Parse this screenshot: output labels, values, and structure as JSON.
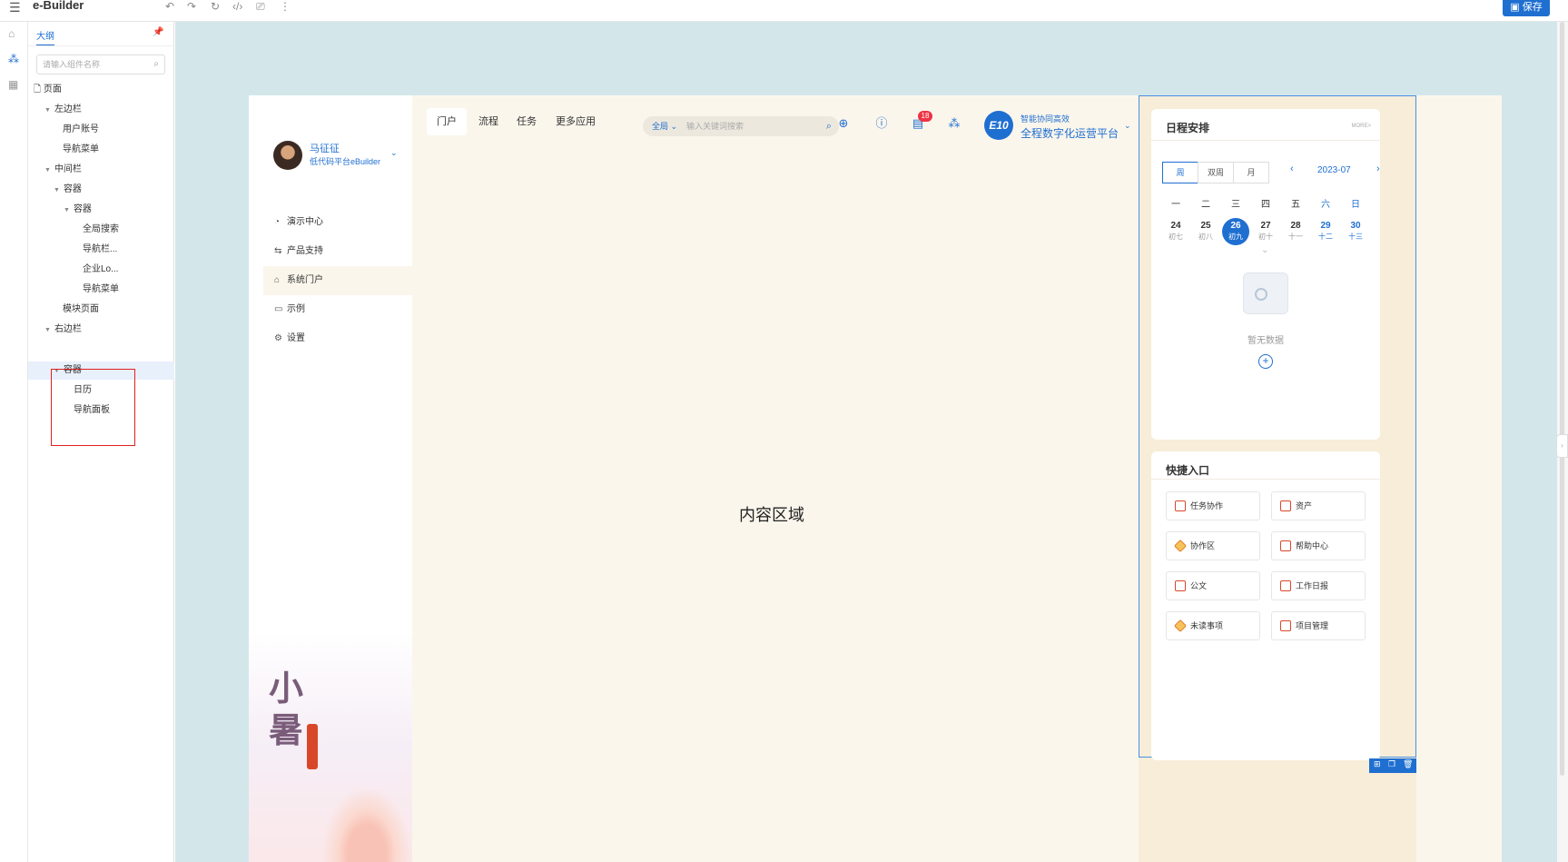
{
  "app": {
    "title": "e-Builder",
    "save_label": "保存"
  },
  "outline": {
    "tab_label": "大纲",
    "search_placeholder": "请输入组件名称",
    "tree": [
      {
        "label": "页面"
      },
      {
        "label": "左边栏"
      },
      {
        "label": "用户账号"
      },
      {
        "label": "导航菜单"
      },
      {
        "label": "中间栏"
      },
      {
        "label": "容器"
      },
      {
        "label": "容器"
      },
      {
        "label": "全局搜索"
      },
      {
        "label": "导航栏..."
      },
      {
        "label": "企业Lo..."
      },
      {
        "label": "导航菜单"
      },
      {
        "label": "模块页面"
      },
      {
        "label": "右边栏"
      },
      {
        "label": "容器"
      },
      {
        "label": "日历"
      },
      {
        "label": "导航面板"
      }
    ]
  },
  "user": {
    "name": "马征征",
    "org": "低代码平台eBuilder"
  },
  "side_nav": [
    {
      "label": "演示中心"
    },
    {
      "label": "产品支持"
    },
    {
      "label": "系统门户"
    },
    {
      "label": "示例"
    },
    {
      "label": "设置"
    }
  ],
  "summer": {
    "title_line1": "小",
    "title_line2": "暑"
  },
  "top_nav": [
    {
      "label": "门户"
    },
    {
      "label": "流程"
    },
    {
      "label": "任务"
    },
    {
      "label": "更多应用"
    }
  ],
  "search": {
    "scope": "全局",
    "placeholder": "输入关键词搜索"
  },
  "header": {
    "msg_count": "18"
  },
  "brand": {
    "logo": "E10",
    "slogan": "智能协同高效",
    "name": "全程数字化运营平台"
  },
  "content": {
    "placeholder": "内容区域"
  },
  "schedule": {
    "title": "日程安排",
    "more": "MORE>",
    "views": [
      "周",
      "双周",
      "月"
    ],
    "month": "2023-07",
    "weekdays": [
      "一",
      "二",
      "三",
      "四",
      "五",
      "六",
      "日"
    ],
    "days": [
      {
        "d": "24",
        "l": "初七"
      },
      {
        "d": "25",
        "l": "初八"
      },
      {
        "d": "26",
        "l": "初九"
      },
      {
        "d": "27",
        "l": "初十"
      },
      {
        "d": "28",
        "l": "十一"
      },
      {
        "d": "29",
        "l": "十二"
      },
      {
        "d": "30",
        "l": "十三"
      }
    ],
    "empty_text": "暂无数据"
  },
  "quick": {
    "title": "快捷入口",
    "items": [
      {
        "label": "任务协作"
      },
      {
        "label": "资产"
      },
      {
        "label": "协作区"
      },
      {
        "label": "帮助中心"
      },
      {
        "label": "公文"
      },
      {
        "label": "工作日报"
      },
      {
        "label": "未读事项"
      },
      {
        "label": "项目管理"
      }
    ]
  }
}
